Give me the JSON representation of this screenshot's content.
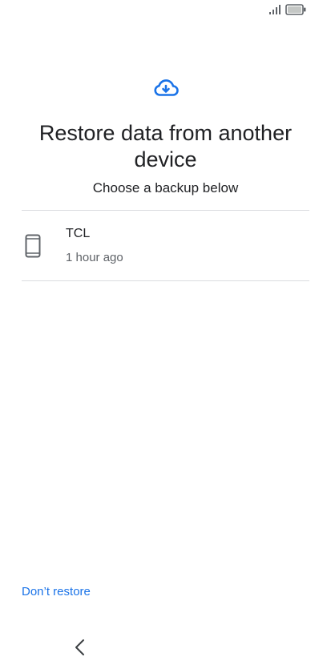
{
  "status_bar": {
    "signal_icon": "signal-bars-icon",
    "battery_icon": "battery-icon"
  },
  "header": {
    "icon": "cloud-download-icon",
    "title": "Restore data from another device",
    "subtitle": "Choose a backup below"
  },
  "backups": [
    {
      "icon": "phone-icon",
      "name": "TCL",
      "time": "1 hour ago"
    }
  ],
  "footer": {
    "dont_restore_label": "Don’t restore"
  },
  "nav": {
    "back_icon": "back-chevron-icon"
  },
  "colors": {
    "accent": "#1a73e8",
    "text_primary": "#202124",
    "text_secondary": "#5f6368",
    "divider": "#dadce0"
  }
}
